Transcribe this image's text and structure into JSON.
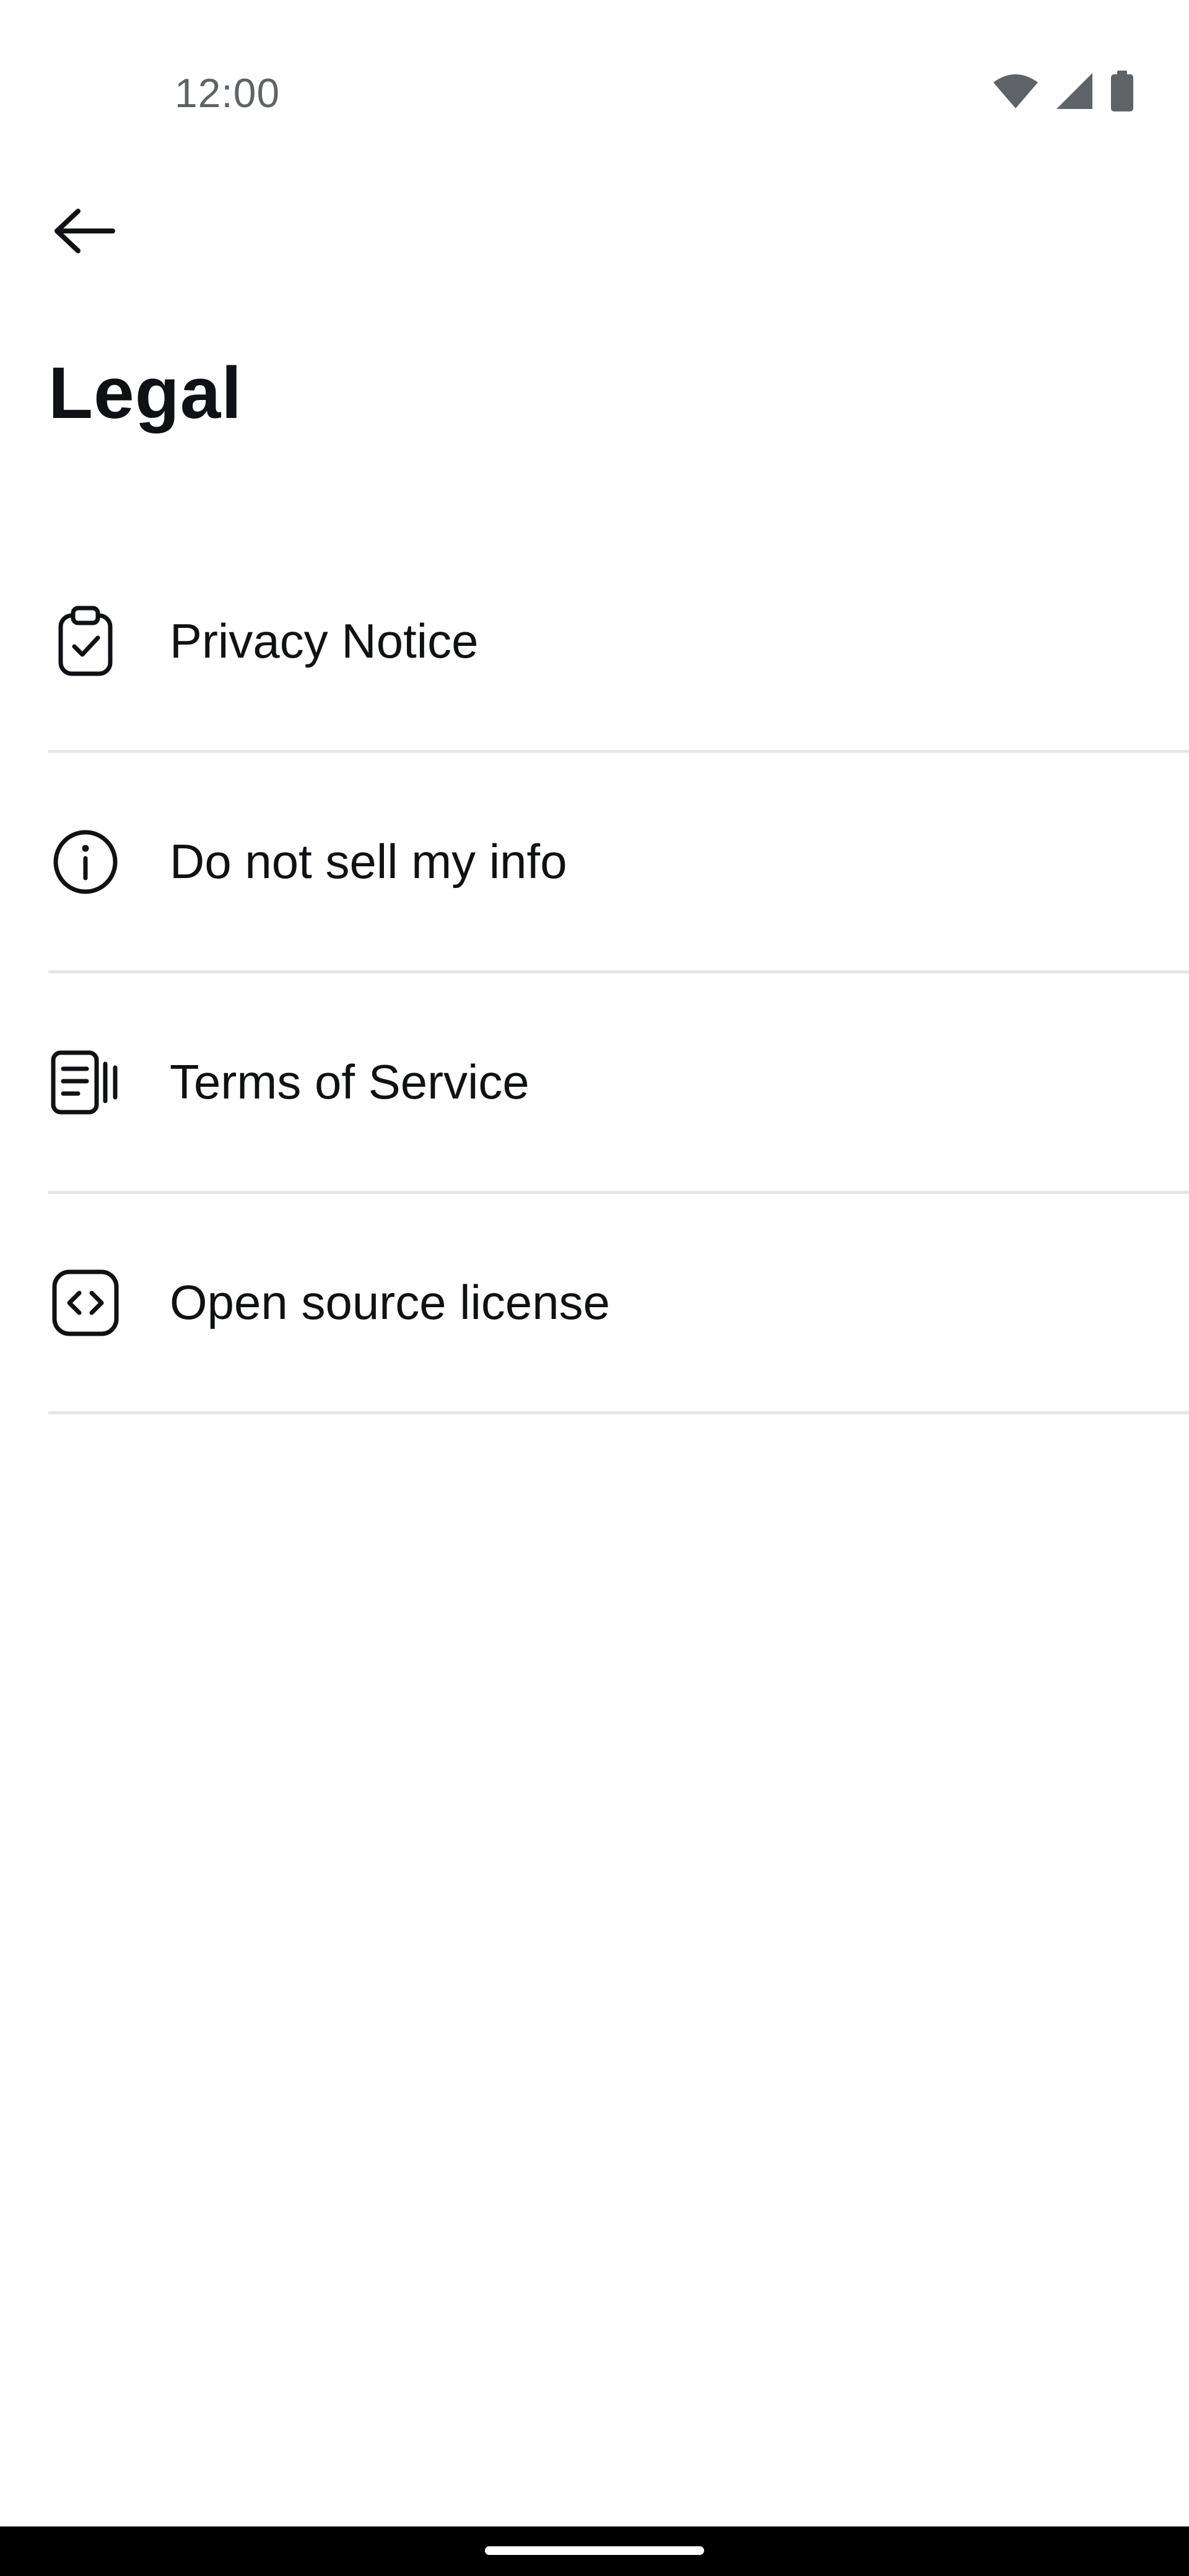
{
  "status_bar": {
    "time": "12:00",
    "icons": [
      "wifi-icon",
      "cellular-signal-icon",
      "battery-icon"
    ]
  },
  "header": {
    "back_icon": "arrow-left-icon",
    "title": "Legal"
  },
  "items": [
    {
      "label": "Privacy Notice",
      "icon": "clipboard-check-icon"
    },
    {
      "label": "Do not sell my info",
      "icon": "info-circle-icon"
    },
    {
      "label": "Terms of Service",
      "icon": "document-lines-icon"
    },
    {
      "label": "Open source license",
      "icon": "code-brackets-icon"
    }
  ],
  "colors": {
    "text_primary": "#0f1114",
    "text_secondary": "#5f6368",
    "divider": "#e4e6e8",
    "background": "#ffffff",
    "nav_bar": "#000000"
  }
}
